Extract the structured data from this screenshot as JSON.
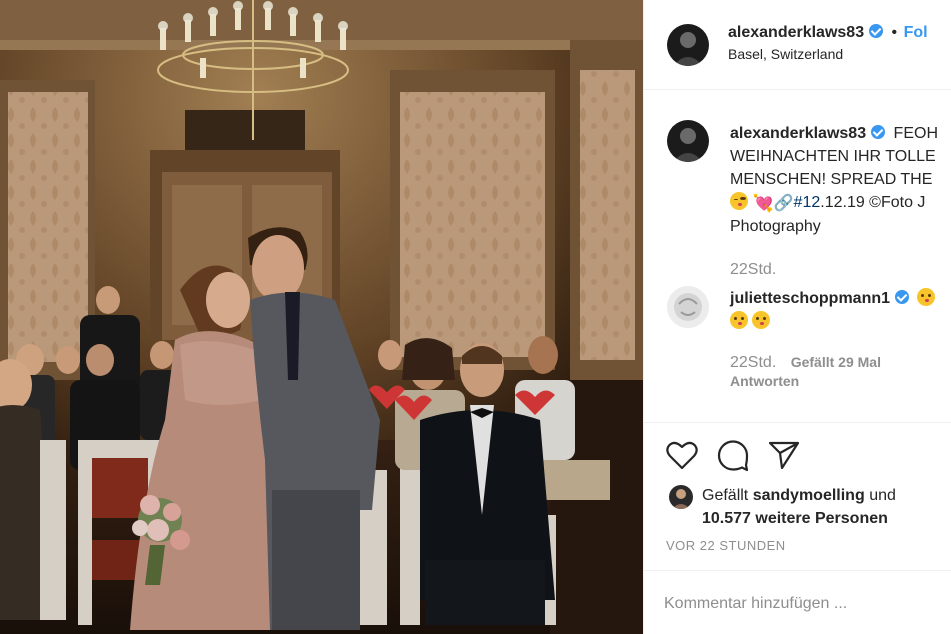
{
  "header": {
    "username": "alexanderklaws83",
    "follow_dot": "•",
    "follow_label": "Fol",
    "location": "Basel, Switzerland"
  },
  "caption": {
    "username": "alexanderklaws83",
    "line1": "FEOH",
    "line2": "WEIHNACHTEN IHR TOLLE",
    "line3": "MENSCHEN! SPREAD THE",
    "hashtag": "#12",
    "date_rest": ".12.19 ©Foto J",
    "line5": "Photography",
    "time": "22Std."
  },
  "comment": {
    "username": "julietteschoppmann1",
    "time": "22Std.",
    "likes": "Gefällt 29 Mal",
    "reply": "Antworten"
  },
  "actions": {
    "like_icon": "heart-outline-icon",
    "comment_icon": "speech-bubble-icon",
    "share_icon": "paper-plane-icon"
  },
  "likes": {
    "prefix": "Gefällt",
    "user": "sandymoelling",
    "und": "und",
    "others": "10.577 weitere Personen"
  },
  "timestamp": "VOR 22 STUNDEN",
  "comment_input": {
    "placeholder": "Kommentar hinzufügen ..."
  },
  "colors": {
    "verified": "#3897f0",
    "follow": "#3897f0",
    "text": "#262626",
    "muted": "#8e8e8e"
  }
}
